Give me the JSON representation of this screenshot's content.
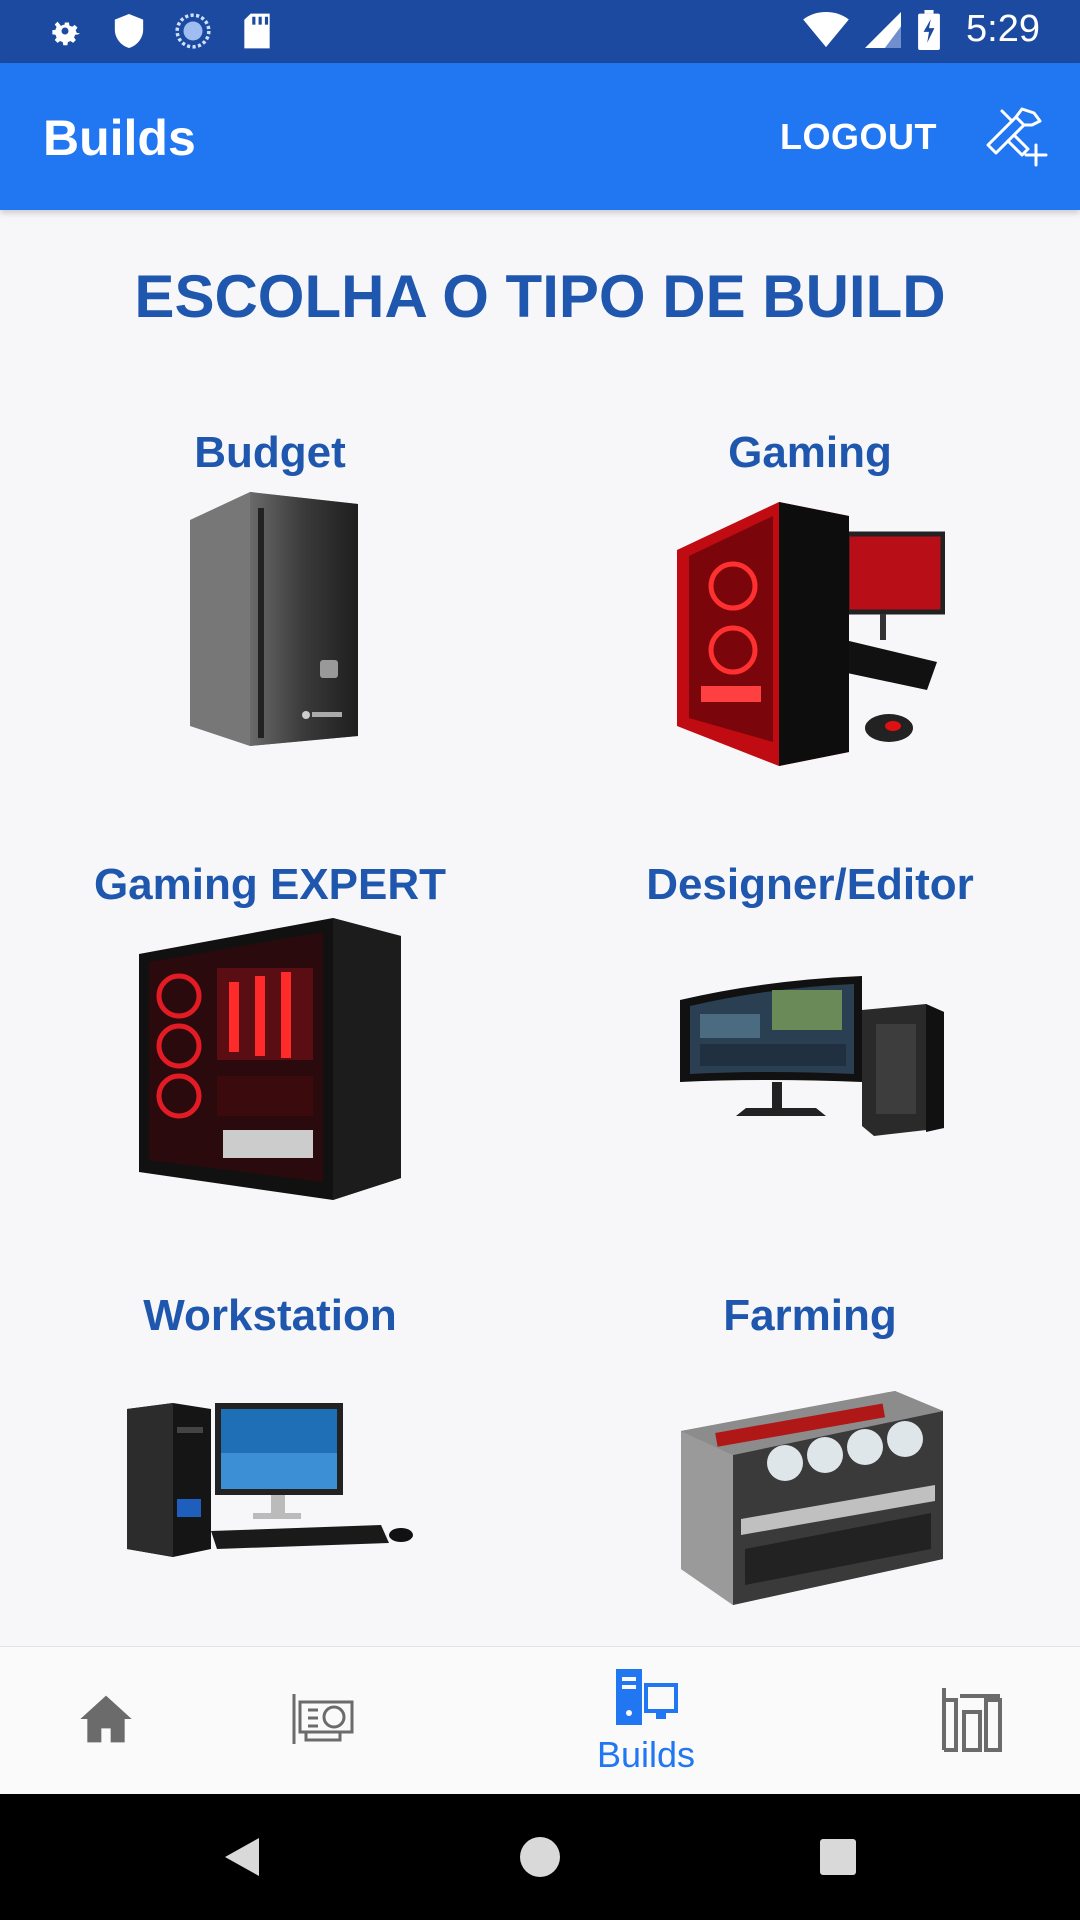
{
  "status_bar": {
    "time": "5:29",
    "icons": [
      "settings-icon",
      "shield-icon",
      "sync-icon",
      "sd-card-icon",
      "wifi-icon",
      "signal-icon",
      "battery-charging-icon"
    ]
  },
  "app_bar": {
    "title": "Builds",
    "logout_label": "LOGOUT",
    "action_icon": "build-tools-icon"
  },
  "heading": "ESCOLHA O TIPO DE BUILD",
  "builds": [
    {
      "label": "Budget",
      "image": "budget-pc-image"
    },
    {
      "label": "Gaming",
      "image": "gaming-pc-image"
    },
    {
      "label": "Gaming EXPERT",
      "image": "gaming-expert-pc-image"
    },
    {
      "label": "Designer/Editor",
      "image": "designer-editor-pc-image"
    },
    {
      "label": "Workstation",
      "image": "workstation-pc-image"
    },
    {
      "label": "Farming",
      "image": "mining-rig-image"
    }
  ],
  "bottom_nav": {
    "items": [
      {
        "icon": "home-icon",
        "label": ""
      },
      {
        "icon": "graphics-card-icon",
        "label": ""
      },
      {
        "icon": "builds-icon",
        "label": "Builds",
        "active": true
      },
      {
        "icon": "compare-icon",
        "label": ""
      }
    ]
  },
  "colors": {
    "status_bar": "#1b4aa0",
    "app_bar": "#2176f2",
    "heading_text": "#1e57ad",
    "active_nav": "#2176f2",
    "inactive_nav": "#6b6b6b"
  }
}
